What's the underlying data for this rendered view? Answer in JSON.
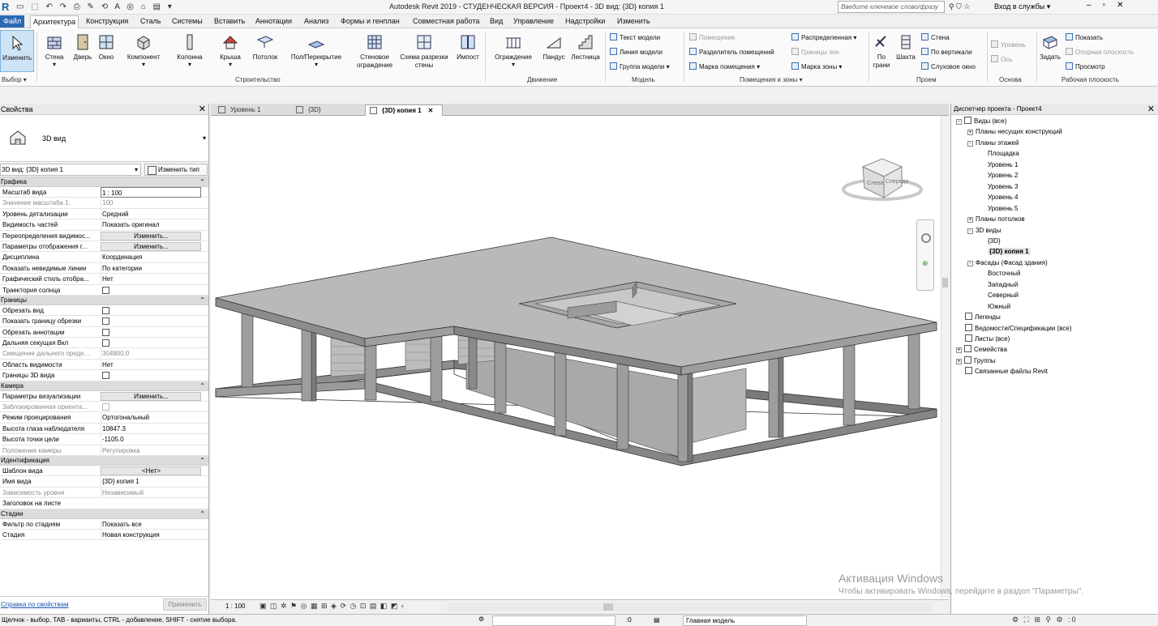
{
  "title": {
    "app_title": "Autodesk Revit 2019 - СТУДЕНЧЕСКАЯ ВЕРСИЯ - Проект4 - 3D вид: {3D} копия 1",
    "search_placeholder": "Введите ключевое слово/фразу",
    "sign_in": "Вход в службы"
  },
  "menu": [
    "Файл",
    "Архитектура",
    "Конструкция",
    "Сталь",
    "Системы",
    "Вставить",
    "Аннотации",
    "Анализ",
    "Формы и генплан",
    "Совместная работа",
    "Вид",
    "Управление",
    "Надстройки",
    "Изменить"
  ],
  "ribbon": {
    "select": {
      "modify": "Изменить",
      "select": "Выбор"
    },
    "build": {
      "wall": "Стена",
      "door": "Дверь",
      "window": "Окно",
      "component": "Компонент",
      "column": "Колонна",
      "roof": "Крыша",
      "ceiling": "Потолок",
      "floor": "Пол/Перекрытие",
      "curtain_system": "Стеновое ограждение",
      "curtain_grid": "Схема разрезки стены",
      "mullion": "Импост",
      "group": "Строительство"
    },
    "circulation": {
      "railing": "Ограждение",
      "ramp": "Пандус",
      "stair": "Лестница",
      "group": "Движение"
    },
    "model": {
      "model_text": "Текст модели",
      "model_line": "Линия модели",
      "model_group": "Группа модели",
      "group": "Модель"
    },
    "room": {
      "room": "Помещение",
      "room_separator": "Разделитель помещений",
      "room_tag": "Марка помещения",
      "area": "Распределенная",
      "area_boundary": "Границы зон",
      "area_tag": "Марка зоны",
      "group": "Помещения и зоны"
    },
    "opening": {
      "by_face": "По грани",
      "shaft": "Шахта",
      "wall": "Стена",
      "vertical": "По вертикали",
      "dormer": "Слуховое окно",
      "group": "Проем"
    },
    "datum": {
      "level": "Уровень",
      "grid": "Ось",
      "group": "Основа"
    },
    "workplane": {
      "set": "Задать",
      "show": "Показать",
      "ref_plane": "Опорная плоскость",
      "viewer": "Просмотр",
      "group": "Рабочая плоскость"
    }
  },
  "properties": {
    "header": "Свойства",
    "type_name": "3D вид",
    "instance": "3D вид: {3D} копия 1",
    "edit_type": "Изменить тип",
    "sections": [
      {
        "name": "Графика",
        "rows": [
          {
            "k": "Масштаб вида",
            "v": "1 : 100",
            "t": "inp"
          },
          {
            "k": "Значение масштаба    1:",
            "v": "100",
            "t": "dis"
          },
          {
            "k": "Уровень детализации",
            "v": "Средний"
          },
          {
            "k": "Видимость частей",
            "v": "Показать оригинал"
          },
          {
            "k": "Переопределения видимос...",
            "v": "Изменить...",
            "t": "btn"
          },
          {
            "k": "Параметры отображения г...",
            "v": "Изменить...",
            "t": "btn"
          },
          {
            "k": "Дисциплина",
            "v": "Координация"
          },
          {
            "k": "Показать невидимые линии",
            "v": "По категории"
          },
          {
            "k": "Графический стиль отобра...",
            "v": "Нет"
          },
          {
            "k": "Траектория солнца",
            "v": "",
            "t": "cb"
          }
        ]
      },
      {
        "name": "Границы",
        "rows": [
          {
            "k": "Обрезать вид",
            "v": "",
            "t": "cb"
          },
          {
            "k": "Показать границу обрезки",
            "v": "",
            "t": "cb"
          },
          {
            "k": "Обрезать аннотации",
            "v": "",
            "t": "cb"
          },
          {
            "k": "Дальняя секущая Вкл",
            "v": "",
            "t": "cb"
          },
          {
            "k": "Смещение дальнего преде...",
            "v": "304800.0",
            "t": "dis"
          },
          {
            "k": "Область видимости",
            "v": "Нет"
          },
          {
            "k": "Границы 3D вида",
            "v": "",
            "t": "cb"
          }
        ]
      },
      {
        "name": "Камера",
        "rows": [
          {
            "k": "Параметры визуализации",
            "v": "Изменить...",
            "t": "btn"
          },
          {
            "k": "Заблокированная ориента...",
            "v": "",
            "t": "cbdis"
          },
          {
            "k": "Режим проецирования",
            "v": "Ортогональный"
          },
          {
            "k": "Высота глаза наблюдателя",
            "v": "10847.3"
          },
          {
            "k": "Высота точки цели",
            "v": "-1105.0"
          },
          {
            "k": "Положение камеры",
            "v": "Регулировка",
            "t": "dis"
          }
        ]
      },
      {
        "name": "Идентификация",
        "rows": [
          {
            "k": "Шаблон вида",
            "v": "<Нет>",
            "t": "btn"
          },
          {
            "k": "Имя вида",
            "v": "{3D} копия 1"
          },
          {
            "k": "Зависимость уровня",
            "v": "Независимый",
            "t": "dis"
          },
          {
            "k": "Заголовок на листе",
            "v": ""
          }
        ]
      },
      {
        "name": "Стадии",
        "rows": [
          {
            "k": "Фильтр по стадиям",
            "v": "Показать все"
          },
          {
            "k": "Стадия",
            "v": "Новая конструкция"
          }
        ]
      }
    ],
    "help_link": "Справка по свойствам",
    "apply": "Применить"
  },
  "tabs": [
    "Уровень 1",
    "{3D}",
    "{3D} копия 1"
  ],
  "viewcube": {
    "left": "Слева",
    "front": "Спереди"
  },
  "view_scale": "1 : 100",
  "browser": {
    "header": "Диспетчер проекта - Проект4",
    "nodes": [
      {
        "label": "Виды (все)",
        "lvl": 0,
        "exp": "-"
      },
      {
        "label": "Планы несущих конструкций",
        "lvl": 1,
        "exp": "+"
      },
      {
        "label": "Планы этажей",
        "lvl": 1,
        "exp": "-"
      },
      {
        "label": "Площадка",
        "lvl": 2
      },
      {
        "label": "Уровень 1",
        "lvl": 2
      },
      {
        "label": "Уровень 2",
        "lvl": 2
      },
      {
        "label": "Уровень 3",
        "lvl": 2
      },
      {
        "label": "Уровень 4",
        "lvl": 2
      },
      {
        "label": "Уровень 5",
        "lvl": 2
      },
      {
        "label": "Планы потолков",
        "lvl": 1,
        "exp": "+"
      },
      {
        "label": "3D виды",
        "lvl": 1,
        "exp": "-"
      },
      {
        "label": "{3D}",
        "lvl": 2
      },
      {
        "label": "{3D} копия 1",
        "lvl": 2,
        "sel": true
      },
      {
        "label": "Фасады (Фасад здания)",
        "lvl": 1,
        "exp": "-"
      },
      {
        "label": "Восточный",
        "lvl": 2
      },
      {
        "label": "Западный",
        "lvl": 2
      },
      {
        "label": "Северный",
        "lvl": 2
      },
      {
        "label": "Южный",
        "lvl": 2
      },
      {
        "label": "Легенды",
        "lvl": 0,
        "icon": true
      },
      {
        "label": "Ведомости/Спецификации (все)",
        "lvl": 0,
        "icon": true
      },
      {
        "label": "Листы (все)",
        "lvl": 0,
        "icon": true
      },
      {
        "label": "Семейства",
        "lvl": 0,
        "exp": "+",
        "icon": true
      },
      {
        "label": "Группы",
        "lvl": 0,
        "exp": "+",
        "icon": true
      },
      {
        "label": "Связанные файлы Revit",
        "lvl": 0,
        "icon": true
      }
    ]
  },
  "status": {
    "message": "Щелчок - выбор, TAB - варианты, CTRL - добавление, SHIFT - снятие выбора.",
    "z1": ":0",
    "workset": "Главная модель",
    "filter_count": ":0"
  },
  "watermark": {
    "title": "Активация Windows",
    "text": "Чтобы активировать Windows, перейдите в раздел \"Параметры\"."
  }
}
